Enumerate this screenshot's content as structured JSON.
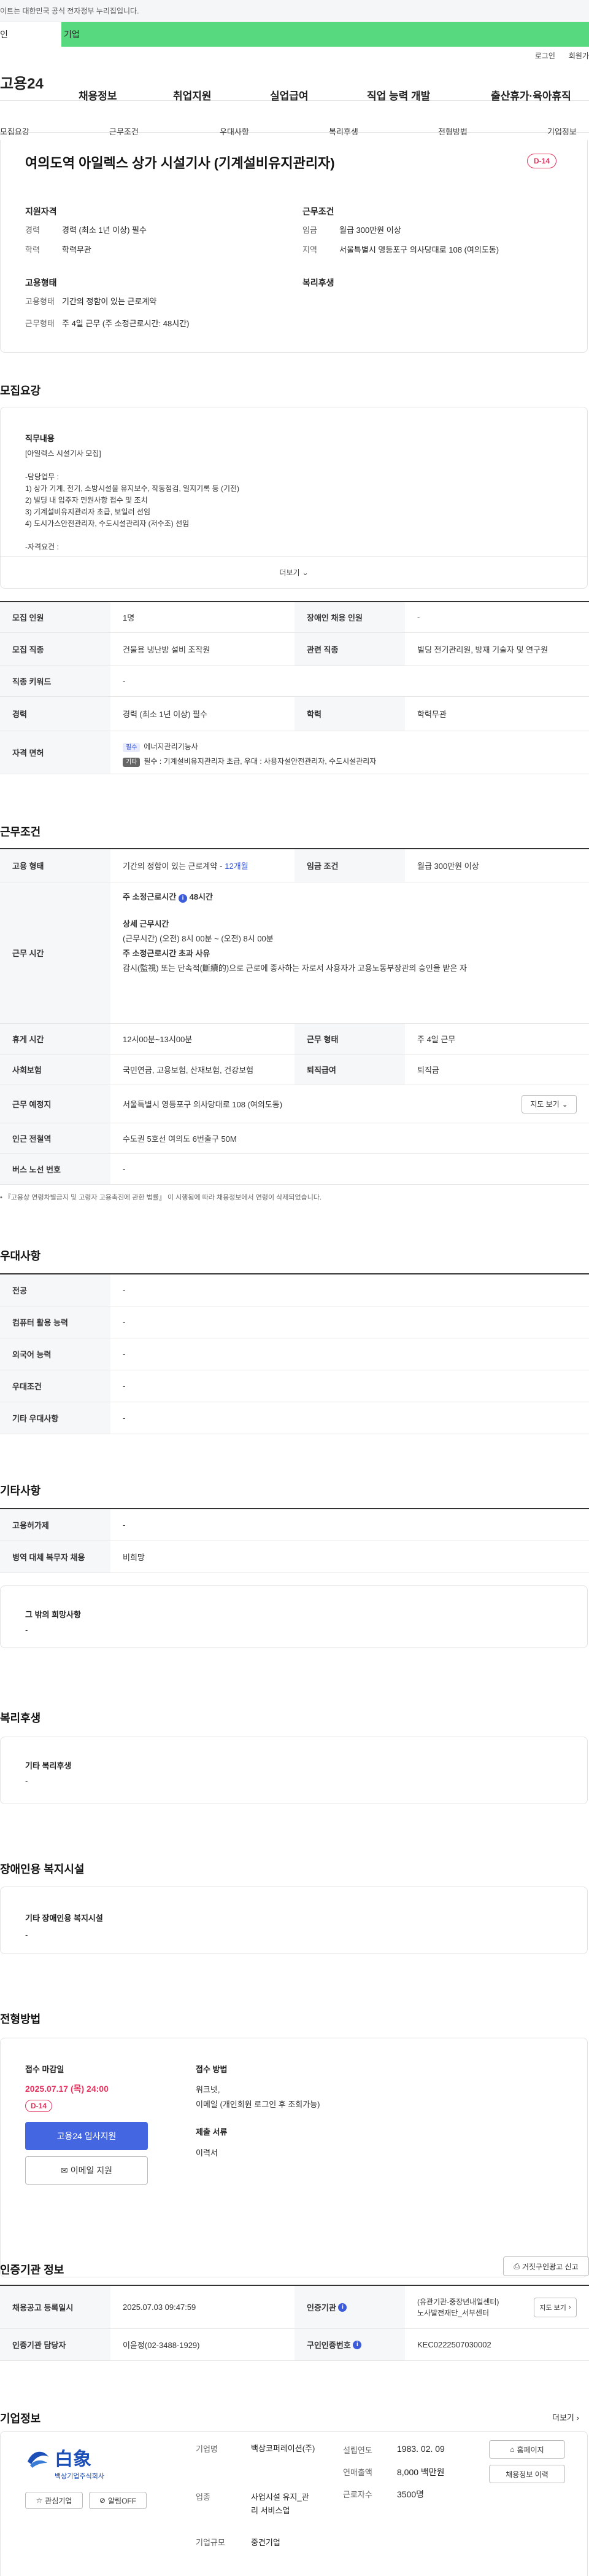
{
  "topbar": {
    "notice": "이트는 대한민국 공식 전자정부 누리집입니다."
  },
  "usertabs": {
    "personal": "인",
    "company": "기업"
  },
  "util": {
    "login": "로그인",
    "join": "회원가"
  },
  "gnb": {
    "logo": "고용24",
    "items": [
      "채용정보",
      "취업지원",
      "실업급여",
      "직업 능력 개발",
      "출산휴가·육아휴직"
    ]
  },
  "subnav": [
    "모집요강",
    "근무조건",
    "우대사항",
    "복리후생",
    "전형방법",
    "기업정보"
  ],
  "job": {
    "title": "여의도역 아일렉스 상가 시설기사 (기계설비유지관리자)",
    "dday": "D-14",
    "qualify": {
      "header": "지원자격",
      "career_k": "경력",
      "career_v": "경력 (최소 1년 이상) 필수",
      "edu_k": "학력",
      "edu_v": "학력무관"
    },
    "cond": {
      "header": "근무조건",
      "pay_k": "임금",
      "pay_v": "월급 300만원 이상",
      "area_k": "지역",
      "area_v": "서울특별시 영등포구 의사당대로 108 (여의도동)"
    },
    "emp": {
      "header": "고용형태",
      "type_k": "고용형태",
      "type_v": "기간의 정함이 있는 근로계약",
      "hours_k": "근무형태",
      "hours_v": "주 4일 근무 (주 소정근로시간: 48시간)"
    },
    "welfare": {
      "header": "복리후생"
    }
  },
  "recruit": {
    "title": "모집요강",
    "content_header": "직무내용",
    "lines": [
      "[아일렉스 시설기사 모집]",
      "",
      "-담당업무 :",
      "1) 상가 기계, 전기, 소방시설물 유지보수, 작동점검, 일지기록 등 (기전)",
      "2) 빌딩 내 입주자 민원사항 접수 및 조치",
      "3) 기계설비유지관리자 초급, 보일러 선임",
      "4) 도시가스안전관리자, 수도시설관리자 (저수조) 선임",
      "",
      "-자격요건 :"
    ],
    "more": "더보기",
    "rows": {
      "r1": {
        "k1": "모집 인원",
        "v1": "1명",
        "k2": "장애인 채용 인원",
        "v2": "-"
      },
      "r2": {
        "k1": "모집 직종",
        "v1": "건물용 냉난방 설비 조작원",
        "k2": "관련 직종",
        "v2": "빌딩 전기관리원, 방재 기술자 및 연구원"
      },
      "r3": {
        "k1": "직종 키워드",
        "v1": "-"
      },
      "r4": {
        "k1": "경력",
        "v1": "경력 (최소 1년 이상) 필수",
        "k2": "학력",
        "v2": "학력무관"
      },
      "r5": {
        "k1": "자격 면허",
        "badge1": "필수",
        "line1": "에너지관리기능사",
        "badge2": "기타",
        "line2": "필수 : 기계설비유지관리자 초급, 우대 : 사용자설안전관리자, 수도시설관리자"
      }
    }
  },
  "workcond": {
    "title": "근무조건",
    "r1": {
      "k1": "고용 형태",
      "v1a": "기간의 정함이 있는 근로계약 - ",
      "v1b": "12개월",
      "k2": "임금 조건",
      "v2": "월급 300만원 이상"
    },
    "r2": {
      "k1": "근무 시간",
      "h1": "주 소정근로시간",
      "h1b": "48시간",
      "h2": "상세 근무시간",
      "l1": "(근무시간) (오전) 8시 00분 ~ (오전) 8시 00분",
      "h3": "주 소정근로시간 초과 사유",
      "l2": "감시(監視) 또는 단속적(斷續的)으로 근로에 종사하는 자로서 사용자가 고용노동부장관의 승인을 받은 자"
    },
    "r3": {
      "k1": "휴게 시간",
      "v1": "12시00분~13시00분",
      "k2": "근무 형태",
      "v2": "주 4일 근무"
    },
    "r4": {
      "k1": "사회보험",
      "v1": "국민연금, 고용보험, 산재보험, 건강보험",
      "k2": "퇴직급여",
      "v2": "퇴직금"
    },
    "r5": {
      "k1": "근무 예정지",
      "v1": "서울특별시 영등포구 의사당대로 108 (여의도동)",
      "btn": "지도 보기"
    },
    "r6": {
      "k1": "인근 전철역",
      "v1": "수도권 5호선 여의도 6번출구 50M"
    },
    "r7": {
      "k1": "버스 노선 번호",
      "v1": "-"
    },
    "note": "• 『고용상 연령차별금지 및 고령자 고용촉진에 관한 법률』 이 시행됨에 따라 채용정보에서 연령이 삭제되었습니다."
  },
  "pref": {
    "title": "우대사항",
    "rows": [
      {
        "k": "전공",
        "v": "-"
      },
      {
        "k": "컴퓨터 활용 능력",
        "v": "-"
      },
      {
        "k": "외국어 능력",
        "v": "-"
      },
      {
        "k": "우대조건",
        "v": "-"
      },
      {
        "k": "기타 우대사항",
        "v": "-"
      }
    ]
  },
  "etc": {
    "title": "기타사항",
    "rows": [
      {
        "k": "고용허가제",
        "v": "-"
      },
      {
        "k": "병역 대체 복무자 채용",
        "v": "비희망"
      }
    ],
    "box_title": "그 밖의 희망사항",
    "box_v": "-"
  },
  "welfare": {
    "title": "복리후생",
    "box_title": "기타 복리후생",
    "box_v": "-"
  },
  "disab": {
    "title": "장애인용 복지시설",
    "box_title": "기타 장애인용 복지시설",
    "box_v": "-"
  },
  "process": {
    "title": "전형방법",
    "deadline_h": "접수 마감일",
    "deadline": "2025.07.17 (목) 24:00",
    "dday": "D-14",
    "apply_btn": "고용24 입사지원",
    "email_btn": "이메일 지원",
    "method_h": "접수 방법",
    "method1": "워크넷,",
    "method2": "이메일 (개인회원 로그인 후 조회가능)",
    "docs_h": "제출 서류",
    "docs_v": "이력서"
  },
  "agency": {
    "title": "인증기관 정보",
    "report_btn": "거짓구인광고 신고",
    "r1": {
      "k1": "채용공고 등록일시",
      "v1": "2025.07.03 09:47:59",
      "k2": "인증기관",
      "v2a": "(유관기관-중장년내일센터)",
      "v2b": "노사발전재단_서부센터",
      "btn": "지도 보기"
    },
    "r2": {
      "k1": "인증기관 담당자",
      "v1": "이윤정(02-3488-1929)",
      "k2": "구인인증번호",
      "v2": "KEC0222507030002"
    }
  },
  "company": {
    "title": "기업정보",
    "more": "더보기",
    "logo_text": "白象",
    "logo_sub": "백상기업주식회사",
    "fav_btn": "관심기업",
    "alert_btn": "알림OFF",
    "name_k": "기업명",
    "name_v": "백상코퍼레이션(주)",
    "ind_k": "업종",
    "ind_v1": "사업시설 유지_관",
    "ind_v2": "리 서비스업",
    "size_k": "기업규모",
    "size_v": "중견기업",
    "est_k": "설립연도",
    "est_v": "1983. 02. 09",
    "rev_k": "연매출액",
    "rev_v": "8,000 백만원",
    "emp_k": "근로자수",
    "emp_v": "3500명",
    "home_btn": "홈페이지",
    "jobs_btn": "채용정보 이력"
  },
  "colors": {
    "accent": "#3b5bdb",
    "green": "#57d97f",
    "red": "#e3335e"
  }
}
